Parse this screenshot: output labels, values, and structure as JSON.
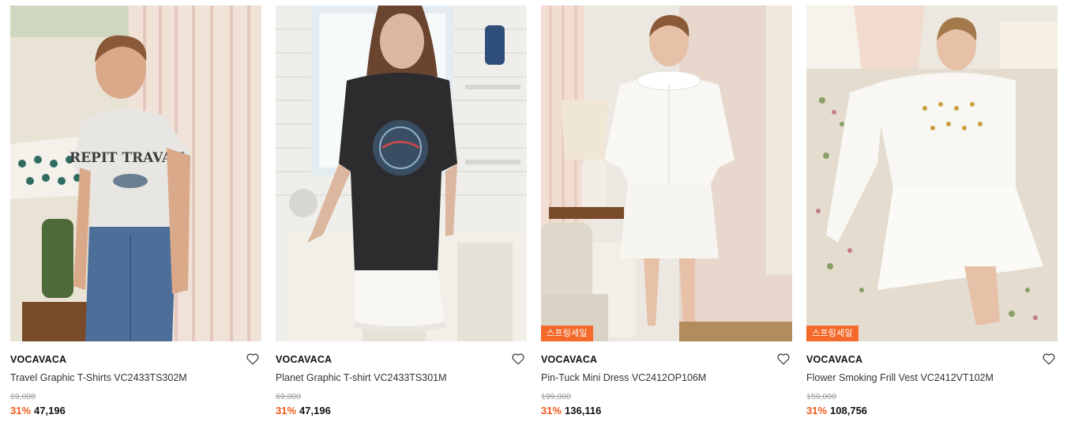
{
  "products": [
    {
      "brand": "VOCAVACA",
      "name": "Travel Graphic T-Shirts VC2433TS302M",
      "original_price": "69,000",
      "discount": "31%",
      "price": "47,196",
      "badge": "",
      "image_label": "REPIT TRAVAIL"
    },
    {
      "brand": "VOCAVACA",
      "name": "Planet Graphic T-shirt VC2433TS301M",
      "original_price": "69,000",
      "discount": "31%",
      "price": "47,196",
      "badge": ""
    },
    {
      "brand": "VOCAVACA",
      "name": "Pin-Tuck Mini Dress VC2412OP106M",
      "original_price": "199,000",
      "discount": "31%",
      "price": "136,116",
      "badge": "스프링세일"
    },
    {
      "brand": "VOCAVACA",
      "name": "Flower Smoking Frill Vest VC2412VT102M",
      "original_price": "159,000",
      "discount": "31%",
      "price": "108,756",
      "badge": "스프링세일"
    }
  ],
  "colors": {
    "discount": "#f05a1a",
    "badge_bg": "#f46a2a",
    "strike": "#9a9a9a"
  }
}
